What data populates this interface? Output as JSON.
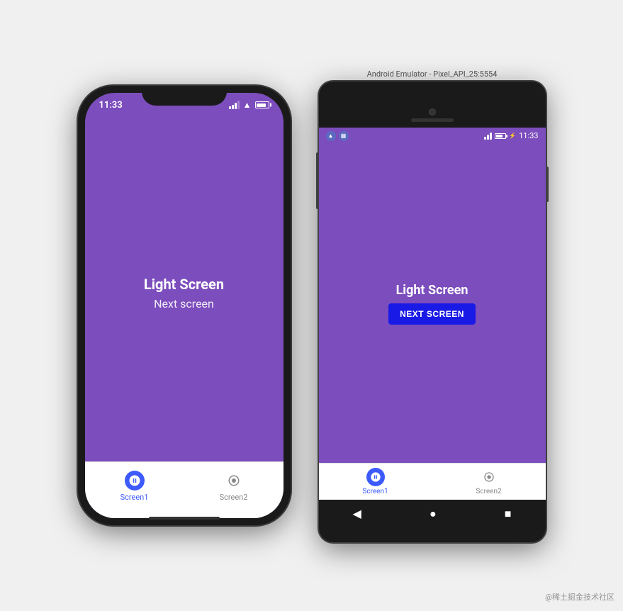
{
  "page": {
    "background": "#f0f0f0",
    "watermark": "@稀土掘金技术社区"
  },
  "android_emulator": {
    "label": "Android Emulator - Pixel_API_25:5554"
  },
  "ios_phone": {
    "status_bar": {
      "time": "11:33"
    },
    "app": {
      "title": "Light Screen",
      "subtitle": "Next screen"
    },
    "bottom_nav": {
      "screen1_label": "Screen1",
      "screen2_label": "Screen2"
    }
  },
  "android_phone": {
    "status_bar": {
      "time": "11:33"
    },
    "app": {
      "title": "Light Screen",
      "button_label": "NEXT SCREEN"
    },
    "bottom_nav": {
      "screen1_label": "Screen1",
      "screen2_label": "Screen2"
    },
    "system_nav": {
      "back": "◀",
      "home": "●",
      "recents": "■"
    }
  }
}
